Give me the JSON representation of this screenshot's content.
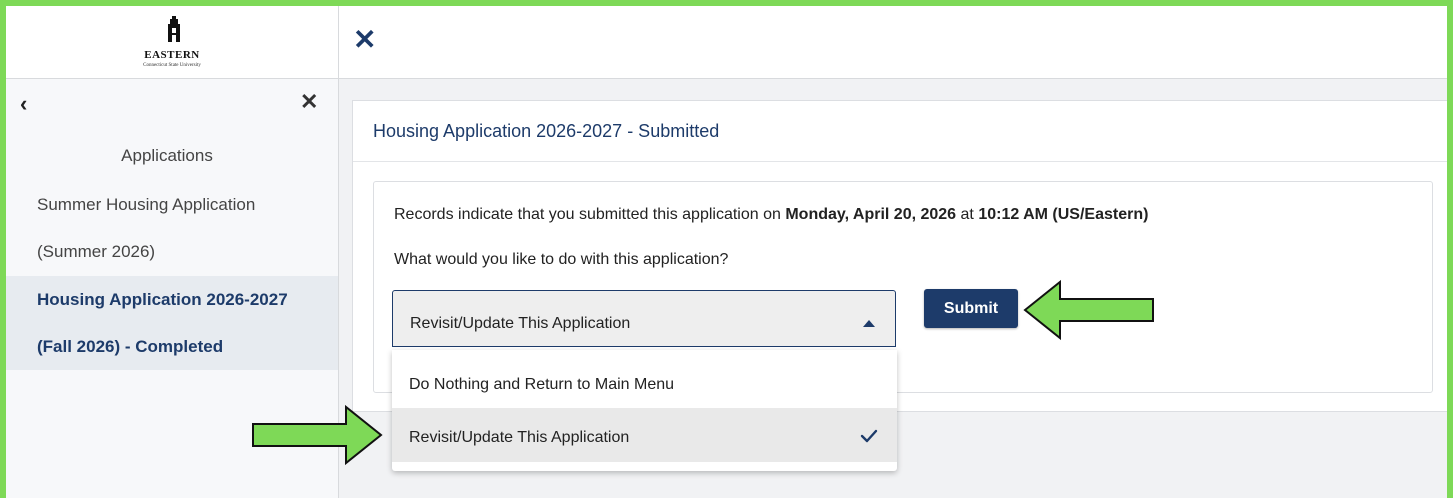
{
  "logo": {
    "name": "EASTERN",
    "subtitle": "Connecticut State University"
  },
  "sidebar": {
    "heading": "Applications",
    "items": [
      {
        "line1": "Summer Housing Application",
        "line2": "(Summer 2026)",
        "active": false
      },
      {
        "line1": "Housing Application 2026-2027",
        "line2": "(Fall 2026) - Completed",
        "active": true
      }
    ]
  },
  "card": {
    "title": "Housing Application 2026-2027 - Submitted",
    "record_prefix": "Records indicate that you submitted this application on ",
    "record_date": "Monday, April 20, 2026",
    "record_mid": " at ",
    "record_time": "10:12 AM (US/Eastern)",
    "question": "What would you like to do with this application?"
  },
  "select": {
    "value": "Revisit/Update This Application",
    "options": [
      {
        "label": "Do Nothing and Return to Main Menu",
        "selected": false
      },
      {
        "label": "Revisit/Update This Application",
        "selected": true
      }
    ]
  },
  "submit_label": "Submit",
  "colors": {
    "brand_navy": "#1d3b6a",
    "highlight_green": "#7ed957",
    "arrow_outline": "#111111"
  },
  "icons": {
    "top_close": "close-icon",
    "sidebar_back": "chevron-left-icon",
    "sidebar_close": "close-icon",
    "select_caret": "caret-up-icon",
    "selected_check": "checkmark-icon"
  }
}
